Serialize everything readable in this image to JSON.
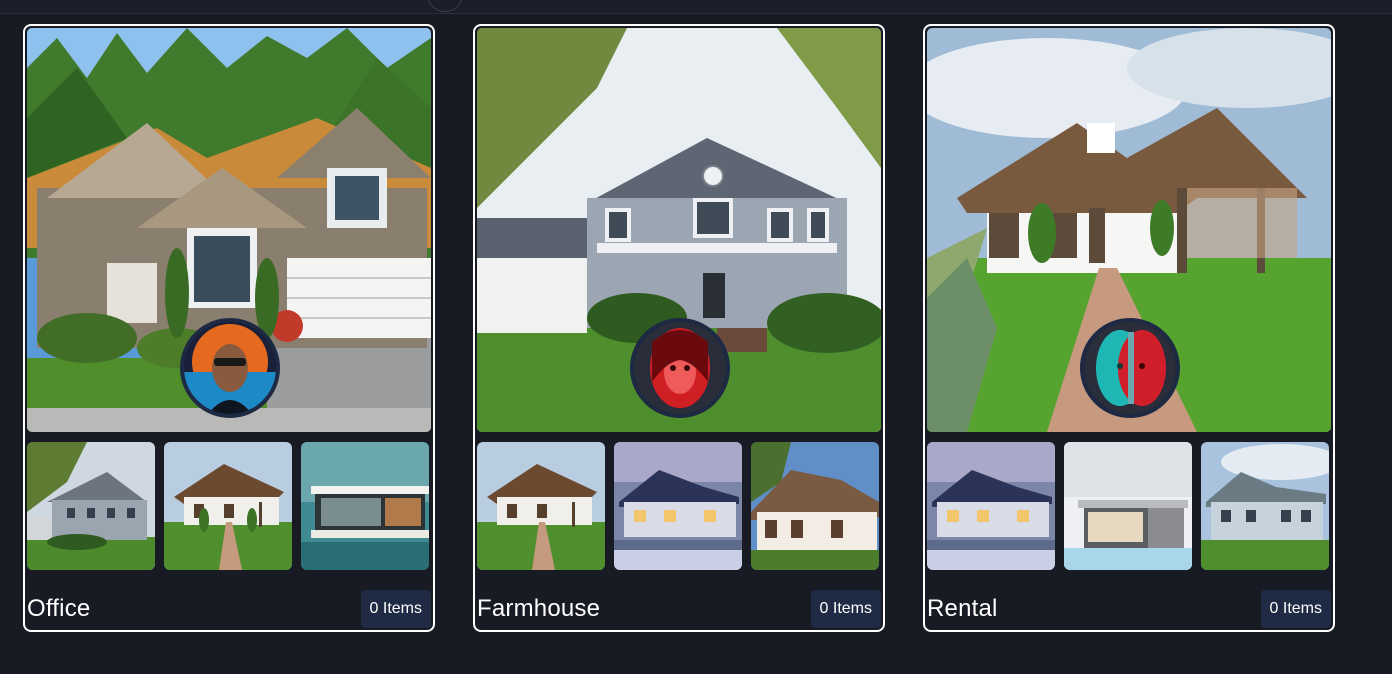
{
  "collections": [
    {
      "name": "Office",
      "count": "0 Items",
      "hero": "large craftsman house with orange shingle roof and pine trees",
      "avatar": "man-neon-portrait",
      "thumbs": [
        "grey colonial house",
        "wooden house with brick path",
        "modern glass house"
      ]
    },
    {
      "name": "Farmhouse",
      "count": "0 Items",
      "hero": "grey two-storey farmhouse with porch and lawn",
      "avatar": "woman-red-portrait",
      "thumbs": [
        "wooden house with brick path",
        "blue house at dusk",
        "brown cottage"
      ]
    },
    {
      "name": "Rental",
      "count": "0 Items",
      "hero": "white house with brown roof and brick path",
      "avatar": "woman-cyan-red-portrait",
      "thumbs": [
        "blue house at dusk",
        "modern pool house",
        "blue farmhouse with porch"
      ]
    }
  ],
  "colors": {
    "card_border": "#ffffff",
    "badge_bg": "#1f2b45",
    "page_bg": "#181a24"
  }
}
